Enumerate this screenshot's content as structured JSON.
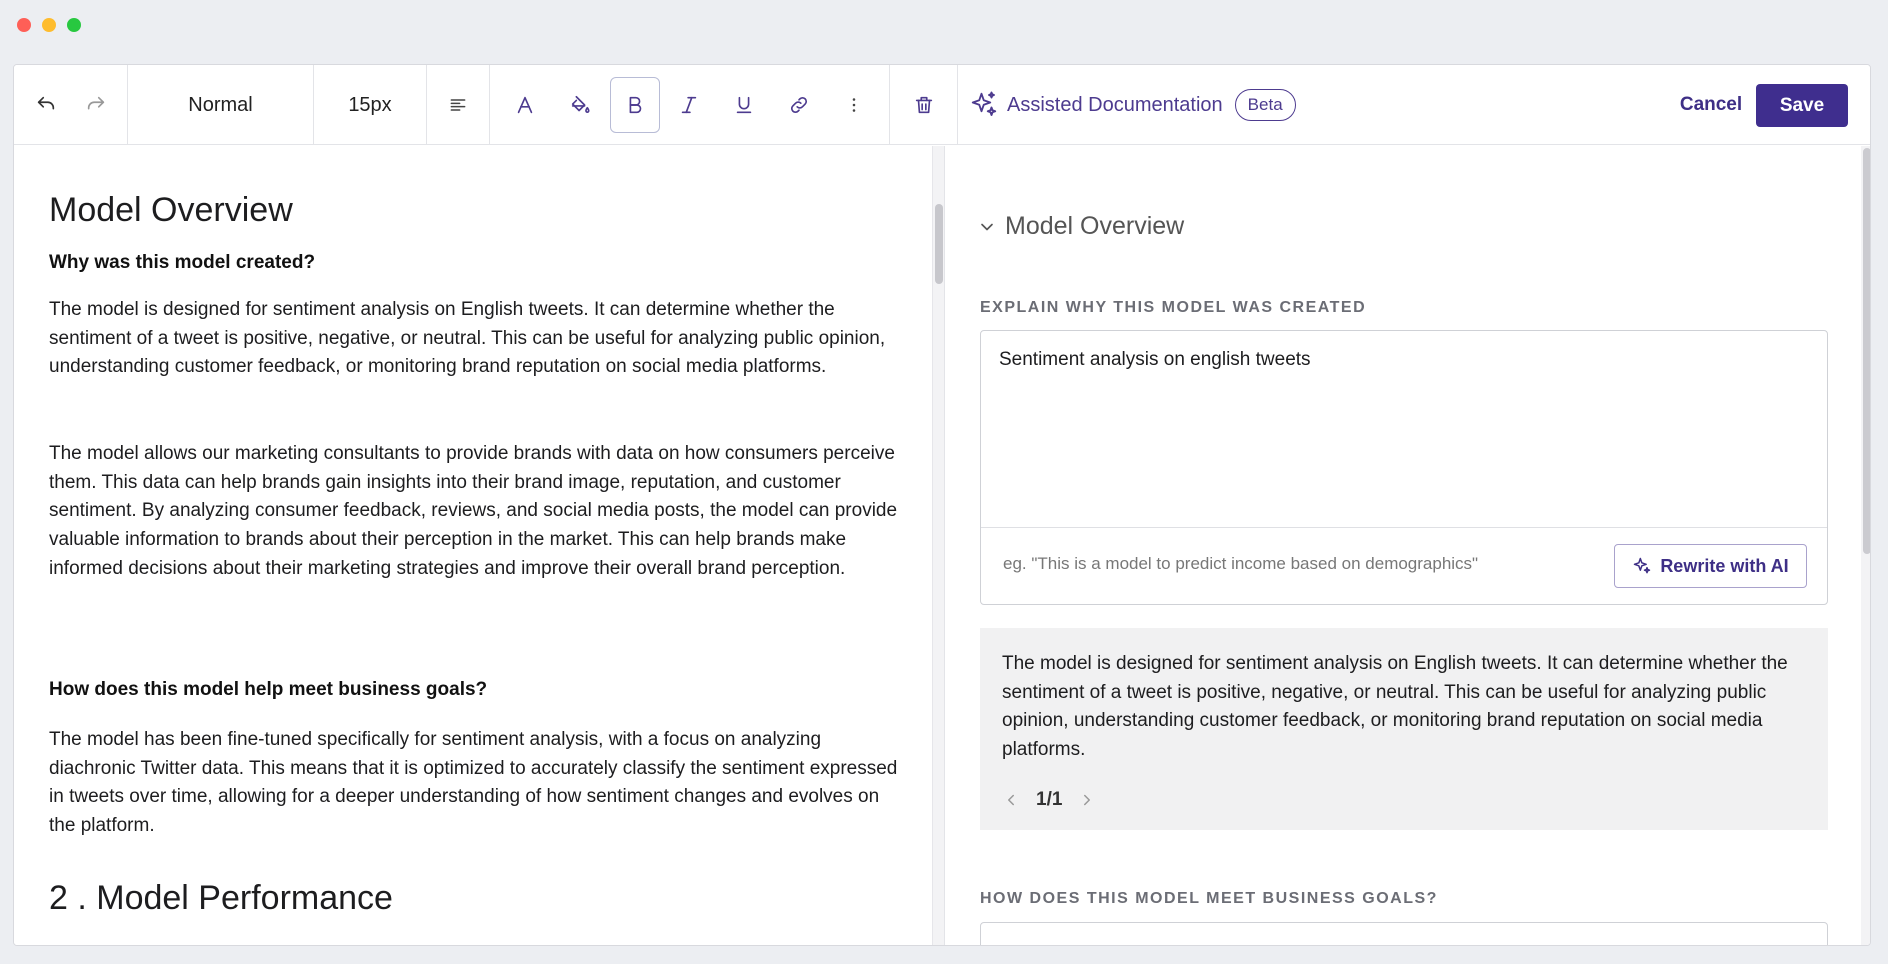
{
  "toolbar": {
    "block_style": "Normal",
    "font_size": "15px",
    "assist_label": "Assisted Documentation",
    "beta_label": "Beta",
    "cancel_label": "Cancel",
    "save_label": "Save"
  },
  "editor": {
    "heading": "Model Overview",
    "question1": "Why was this model created?",
    "para1": "The model is designed for sentiment analysis on English tweets. It can determine whether the sentiment of a tweet is positive, negative, or neutral. This can be useful for analyzing public opinion, understanding customer feedback, or monitoring brand reputation on social media platforms.",
    "para2": "The model allows our marketing consultants to provide brands with data on how consumers perceive them. This data can help brands gain insights into their brand image, reputation, and customer sentiment. By analyzing consumer feedback, reviews, and social media posts, the model can provide valuable information to brands about their perception in the market. This can help brands make informed decisions about their marketing strategies and improve their overall brand perception.",
    "question2": "How does this model help meet business goals?",
    "para3": "The model has been fine-tuned specifically for sentiment analysis, with a focus on analyzing diachronic Twitter data. This means that it is optimized to accurately classify the sentiment expressed in tweets over time, allowing for a deeper understanding of how sentiment changes and evolves on the platform.",
    "heading2": "2 . Model Performance"
  },
  "assistant": {
    "section_title": "Model Overview",
    "label1": "EXPLAIN WHY THIS MODEL WAS CREATED",
    "input_value": "Sentiment analysis on english tweets",
    "input_placeholder": "eg. \"This is a model to predict income based on demographics\"",
    "rewrite_label": "Rewrite with AI",
    "suggestion": "The model is designed for sentiment analysis on English tweets. It can determine whether the sentiment of a tweet is positive, negative, or neutral. This can be useful for analyzing public opinion, understanding customer feedback, or monitoring brand reputation on social media platforms.",
    "pager": "1/1",
    "label2": "HOW DOES THIS MODEL MEET BUSINESS GOALS?"
  },
  "colors": {
    "accent": "#3f2e8e",
    "accent_text": "#4d3b8f"
  },
  "icons": [
    "undo-icon",
    "redo-icon",
    "align-left-icon",
    "font-color-icon",
    "fill-color-icon",
    "bold-icon",
    "italic-icon",
    "underline-icon",
    "link-icon",
    "more-vertical-icon",
    "trash-icon",
    "sparkles-icon",
    "chevron-down-icon",
    "chevron-left-icon",
    "chevron-right-icon"
  ]
}
